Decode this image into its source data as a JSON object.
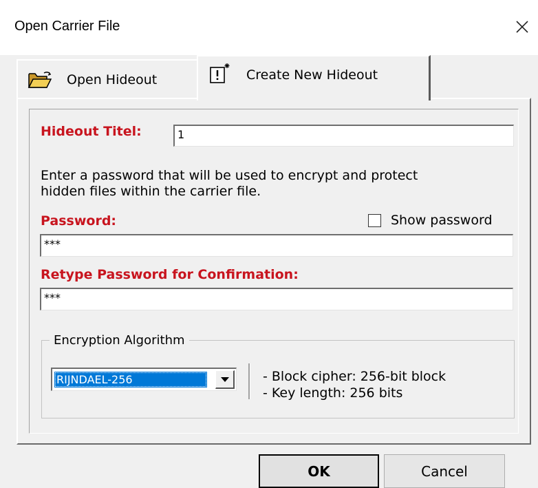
{
  "window": {
    "title": "Open Carrier File"
  },
  "tabs": [
    {
      "label": "Open Hideout",
      "icon": "open-folder-icon",
      "active": false
    },
    {
      "label": "Create New Hideout",
      "icon": "new-document-sparkle-icon",
      "active": true
    }
  ],
  "form": {
    "hideout_title_label": "Hideout Titel:",
    "hideout_title_value": "1",
    "description_line1": "Enter a password that will be used to encrypt and protect",
    "description_line2": "hidden files within the carrier file.",
    "password_label": "Password:",
    "show_password_label": "Show password",
    "show_password_checked": false,
    "password_value": "***",
    "retype_label": "Retype Password for Confirmation:",
    "retype_value": "***"
  },
  "encryption": {
    "group_label": "Encryption Algorithm",
    "selected": "RIJNDAEL-256",
    "info_line1": "- Block cipher: 256-bit block",
    "info_line2": "- Key length: 256 bits"
  },
  "buttons": {
    "ok_label": "OK",
    "cancel_label": "Cancel"
  },
  "colors": {
    "required_label": "#c8141e",
    "selection_highlight": "#0078d7",
    "dialog_background": "#f0f0f0"
  }
}
